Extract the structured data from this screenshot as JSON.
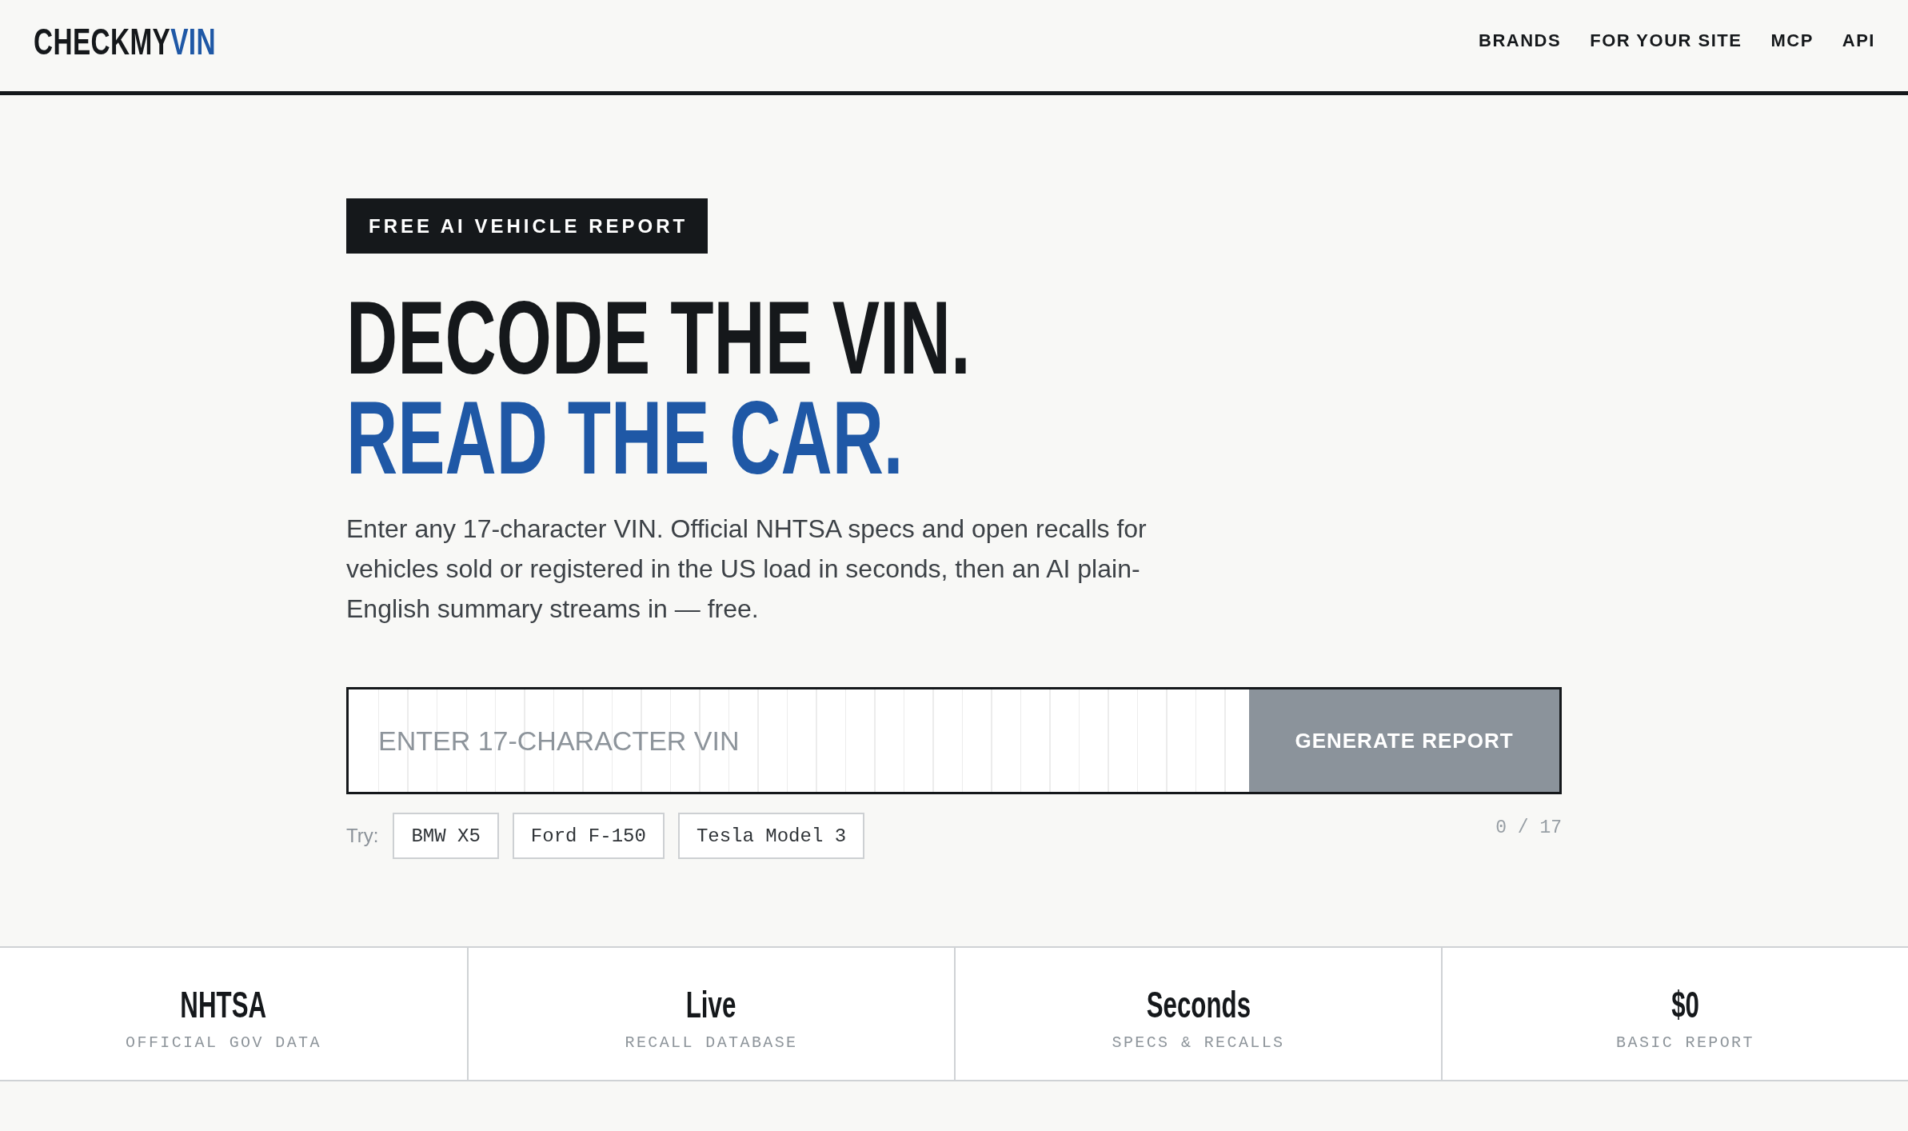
{
  "header": {
    "logo": {
      "text": "CHECKMY",
      "accent": "VIN"
    },
    "nav": [
      "BRANDS",
      "FOR YOUR SITE",
      "MCP",
      "API"
    ]
  },
  "hero": {
    "badge": "FREE AI VEHICLE REPORT",
    "headline": [
      {
        "text": "DECODE THE VIN.",
        "accent": false
      },
      {
        "text": "READ THE CAR.",
        "accent": true
      }
    ],
    "intro": "Enter any 17-character VIN. Official NHTSA specs and open recalls for vehicles sold or registered in the US load in seconds, then an AI plain-English summary streams in — free.",
    "vin_form": {
      "placeholder": "ENTER 17-CHARACTER VIN",
      "button": {
        "label": "GENERATE REPORT",
        "disabled": true
      }
    },
    "examples": {
      "label": "Try:",
      "items": [
        "BMW X5",
        "Ford F-150",
        "Tesla Model 3"
      ]
    },
    "counter": "0 / 17"
  },
  "stats": [
    {
      "value": "NHTSA",
      "label": "OFFICIAL GOV DATA"
    },
    {
      "value": "Live",
      "label": "RECALL DATABASE"
    },
    {
      "value": "Seconds",
      "label": "SPECS & RECALLS"
    },
    {
      "value": "$0",
      "label": "BASIC REPORT"
    }
  ]
}
